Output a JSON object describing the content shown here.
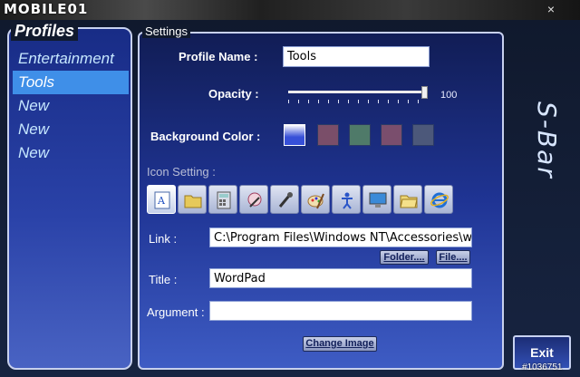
{
  "watermark": "MOBILE01",
  "window": {
    "close_glyph": "×"
  },
  "profiles": {
    "title": "Profiles",
    "items": [
      {
        "label": "Entertainment"
      },
      {
        "label": "Tools"
      },
      {
        "label": "New"
      },
      {
        "label": "New"
      },
      {
        "label": "New"
      }
    ],
    "selected": "Tools"
  },
  "settings": {
    "title": "Settings",
    "profile_name_label": "Profile Name :",
    "profile_name_value": "Tools",
    "opacity_label": "Opacity :",
    "opacity_value": "100",
    "background_color_label": "Background Color :",
    "swatches": [
      "#3750d8",
      "#7a4e69",
      "#4f7a69",
      "#7a4e6d",
      "#4c587a"
    ],
    "icon_setting_label": "Icon Setting :",
    "icons": [
      "wordpad-icon",
      "folder-icon",
      "calculator-icon",
      "paint-icon",
      "microphone-icon",
      "paintbrush-icon",
      "accessibility-icon",
      "display-icon",
      "folder-open-icon",
      "internet-explorer-icon"
    ],
    "link_label": "Link :",
    "link_value": "C:\\Program Files\\Windows NT\\Accessories\\wordpad.exe",
    "folder_button": "Folder....",
    "file_button": "File....",
    "title_label": "Title :",
    "title_value": "WordPad",
    "argument_label": "Argument :",
    "argument_value": "",
    "change_image_button": "Change Image"
  },
  "app_name": "S-Bar",
  "exit_button": "Exit",
  "image_tag": "#1036751",
  "colors": {
    "accent": "#3f8fe8",
    "panel_top": "#182c86",
    "panel_bottom": "#4963c3"
  }
}
